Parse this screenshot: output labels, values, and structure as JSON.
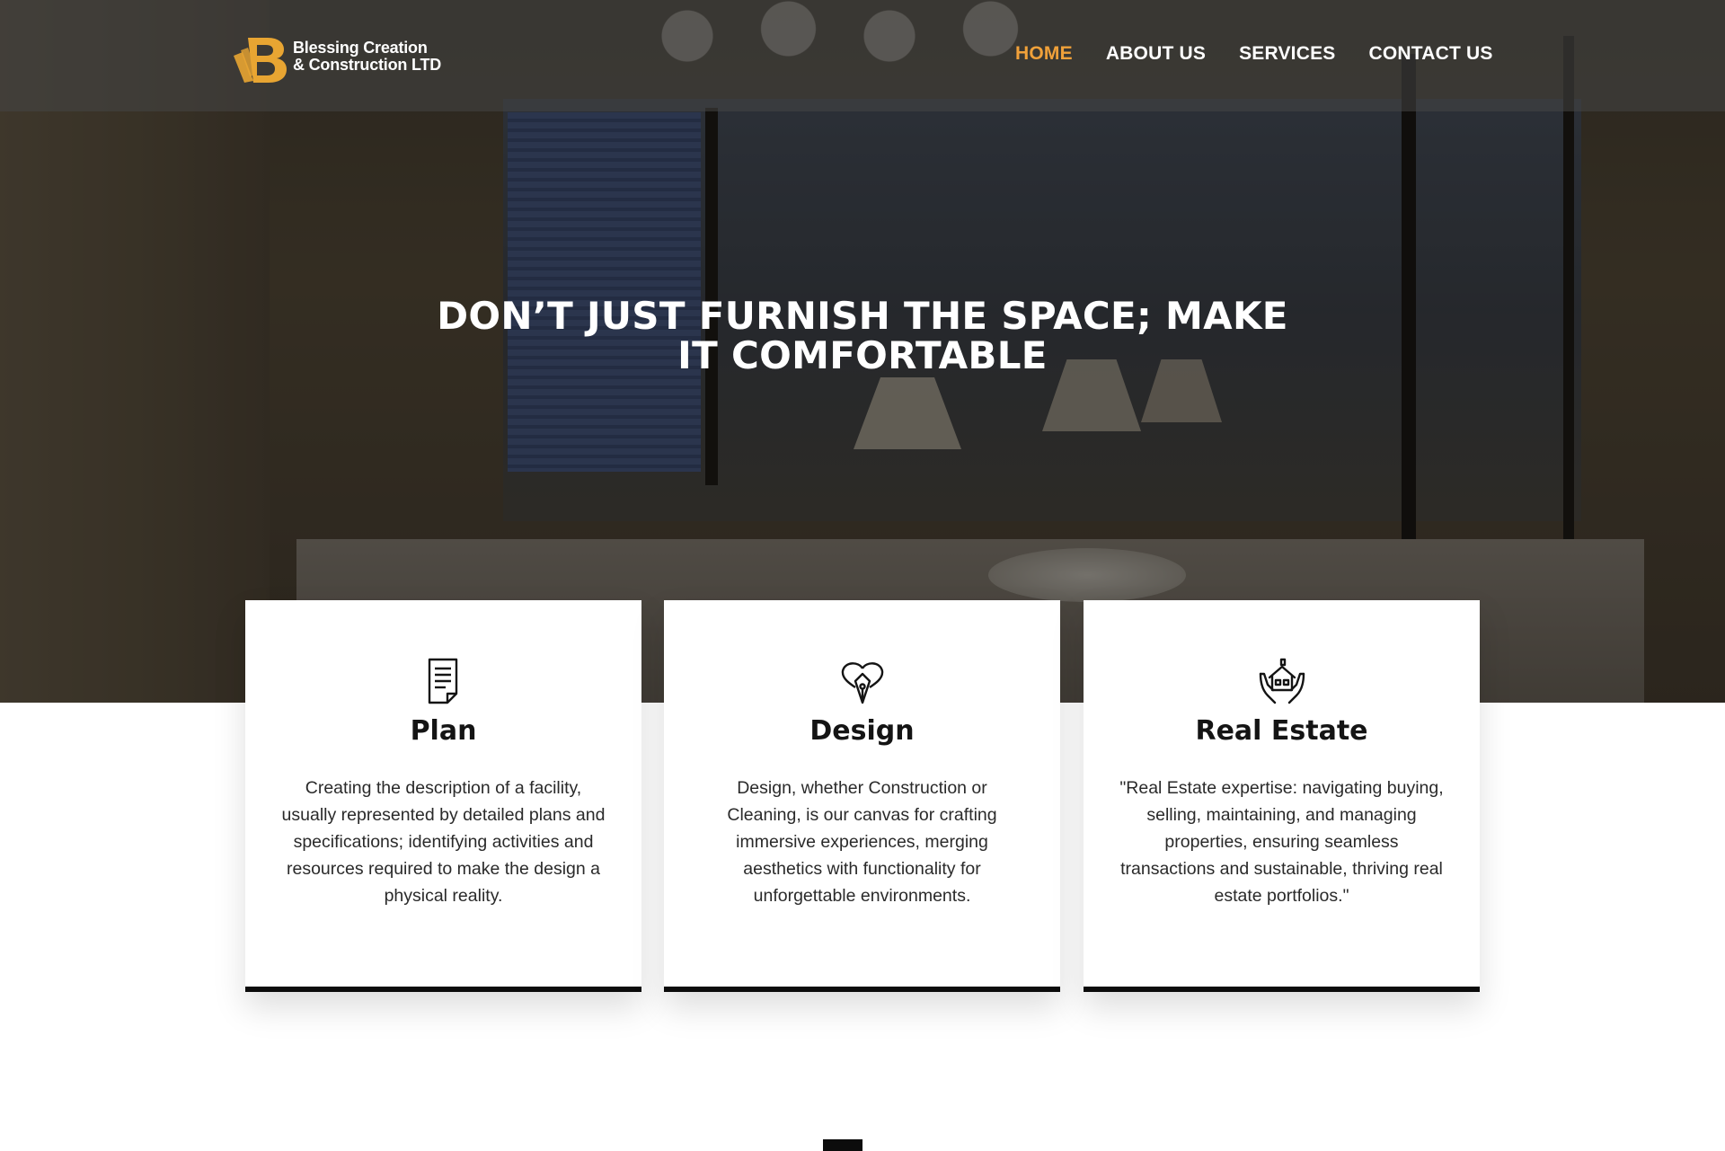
{
  "header": {
    "logo": {
      "line1": "Blessing Creation",
      "line2": "& Construction LTD",
      "mark_color": "#e8a532"
    },
    "nav": [
      {
        "label": "HOME",
        "active": true
      },
      {
        "label": "ABOUT US",
        "active": false
      },
      {
        "label": "SERVICES",
        "active": false
      },
      {
        "label": "CONTACT US",
        "active": false
      }
    ],
    "active_color": "#f0a13a"
  },
  "hero": {
    "headline": "DON’T JUST FURNISH THE SPACE; MAKE IT COMFORTABLE"
  },
  "cards": [
    {
      "icon": "document-icon",
      "title": "Plan",
      "body": "Creating the description of a facility, usually represented by detailed plans and specifications; identifying activities and resources required to make the design a physical reality."
    },
    {
      "icon": "heart-pen-icon",
      "title": "Design",
      "body": "Design, whether Construction or Cleaning, is our canvas for crafting immersive experiences, merging aesthetics with functionality for unforgettable environments."
    },
    {
      "icon": "house-hands-icon",
      "title": "Real Estate",
      "body": "\"Real Estate expertise: navigating buying, selling, maintaining, and managing properties, ensuring seamless transactions and sustainable, thriving real estate portfolios.\""
    }
  ]
}
